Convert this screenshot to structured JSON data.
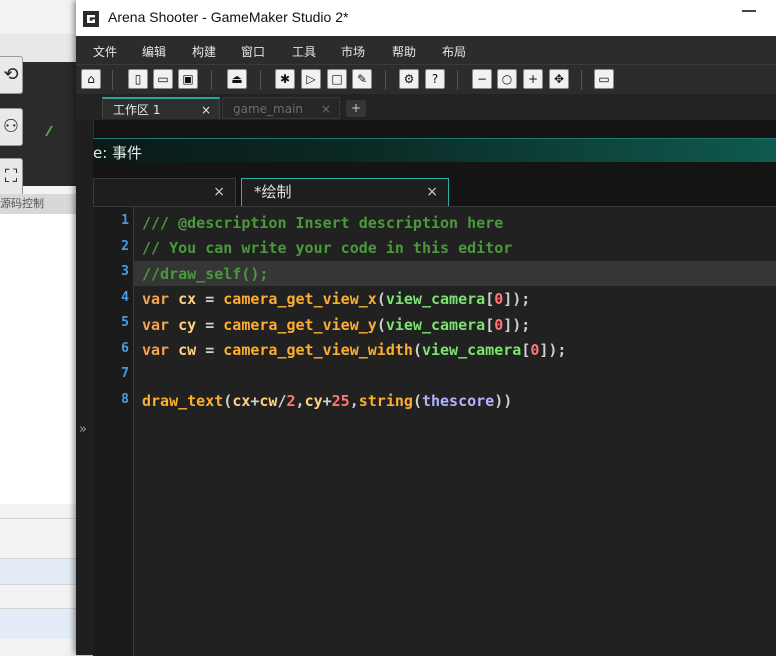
{
  "window": {
    "title": "Arena Shooter - GameMaker Studio 2*"
  },
  "menubar": {
    "items": [
      "文件",
      "编辑",
      "构建",
      "窗口",
      "工具",
      "市场",
      "帮助",
      "布局"
    ]
  },
  "workspace_tabs": [
    {
      "label": "工作区 1",
      "close": "×"
    },
    {
      "label": "game_main",
      "close": "×"
    }
  ],
  "workspace_add": "+",
  "object_header": {
    "label": "e: 事件"
  },
  "event_tabs": [
    {
      "label": "",
      "close": "×"
    },
    {
      "label": "*绘制",
      "close": "×"
    }
  ],
  "background_panel": {
    "label": "源码控制"
  },
  "collapse_glyph": "»",
  "editor": {
    "line_numbers": [
      "1",
      "2",
      "3",
      "4",
      "5",
      "6",
      "7",
      "8"
    ],
    "highlighted_line": 3
  },
  "code": {
    "l1": {
      "comment": "/// @description Insert description here"
    },
    "l2": {
      "comment": "// You can write your code in this editor"
    },
    "l3": {
      "comment": "//draw_self();"
    },
    "l4": {
      "kw": "var",
      "v": "cx",
      "eq": "=",
      "fn": "camera_get_view_x",
      "p1": "(",
      "arg": "view_camera",
      "b1": "[",
      "n": "0",
      "b2": "]",
      "tail": ");"
    },
    "l5": {
      "kw": "var",
      "v": "cy",
      "eq": "=",
      "fn": "camera_get_view_y",
      "p1": "(",
      "arg": "view_camera",
      "b1": "[",
      "n": "0",
      "b2": "]",
      "tail": ");"
    },
    "l6": {
      "kw": "var",
      "v": "cw",
      "eq": "=",
      "fn": "camera_get_view_width",
      "p1": "(",
      "arg": "view_camera",
      "b1": "[",
      "n": "0",
      "b2": "]",
      "tail": ");"
    },
    "l8": {
      "fn": "draw_text",
      "p1": "(",
      "a1": "cx",
      "op1": "+",
      "a2": "cw",
      "op2": "/",
      "n1": "2",
      "c1": ",",
      "a3": "cy",
      "op3": "+",
      "n2": "25",
      "c2": ",",
      "fn2": "string",
      "p2": "(",
      "inst": "thescore",
      "tail": "))"
    }
  },
  "colors": {
    "accent": "#26a69a",
    "comment": "#4a9a3c",
    "keyword": "#f5a350",
    "builtin": "#7be36f",
    "number": "#ff7676",
    "line_number": "#4a9be0"
  }
}
